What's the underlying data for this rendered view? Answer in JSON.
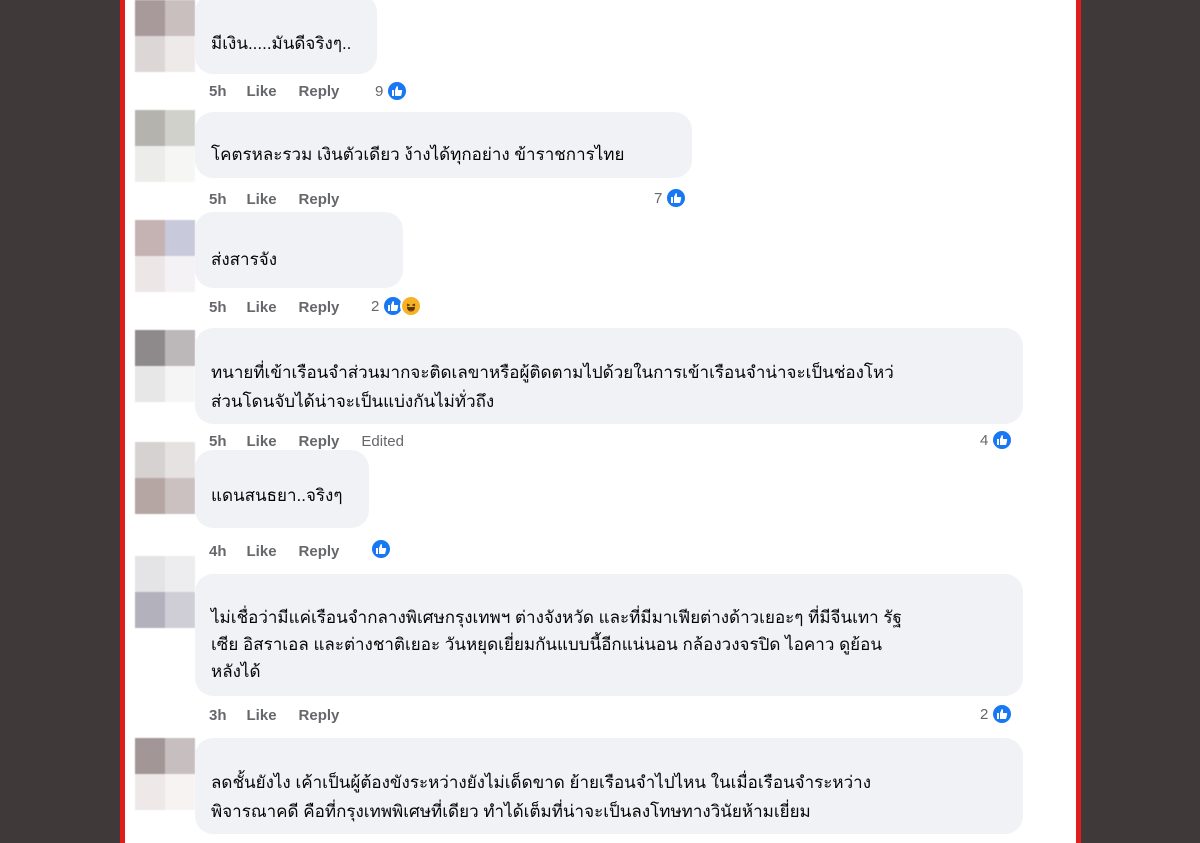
{
  "colors": {
    "page_bg": "#3f3a39",
    "frame_border": "#e21b1b",
    "bubble_bg": "#f0f2f5",
    "text": "#050505",
    "meta_text": "#65676b",
    "like_blue": "#1877f2",
    "haha_yellow": "#f7b125"
  },
  "labels": {
    "like": "Like",
    "reply": "Reply",
    "edited": "Edited"
  },
  "comments": [
    {
      "text": "มีเงิน.....มันดีจริงๆ..",
      "time": "5h",
      "reaction_count": "9",
      "reactions": [
        "like-icon"
      ],
      "avatar_colors": [
        "#a8999a",
        "#c9bfbf",
        "#dcd6d6",
        "#efeaea"
      ]
    },
    {
      "text": "โคตรหละรวม เงินตัวเดียว ง้างได้ทุกอย่าง ข้าราชการไทย",
      "time": "5h",
      "reaction_count": "7",
      "reactions": [
        "like-icon"
      ],
      "avatar_colors": [
        "#b4b3ad",
        "#d1d1cb",
        "#ececea",
        "#f6f6f5"
      ]
    },
    {
      "text": "ส่งสารจัง",
      "time": "5h",
      "reaction_count": "2",
      "reactions": [
        "like-icon",
        "haha-icon"
      ],
      "avatar_colors": [
        "#c5b3b4",
        "#c9c9dc",
        "#ece6e7",
        "#f4f2f4"
      ]
    },
    {
      "text_lines": [
        "ทนายที่เข้าเรือนจำส่วนมากจะติดเลขาหรือผู้ติดตามไปด้วยในการเข้าเรือนจำน่าจะเป็นช่องโหว่",
        "ส่วนโดนจับได้น่าจะเป็นแบ่งกันไม่ทั่วถึง"
      ],
      "time": "5h",
      "edited": true,
      "reaction_count": "4",
      "reactions": [
        "like-icon"
      ],
      "avatar_colors": [
        "#8e8a8b",
        "#bcb7b8",
        "#e8e7e7",
        "#f5f5f5"
      ]
    },
    {
      "text": "แดนสนธยา..จริงๆ",
      "time": "4h",
      "reaction_count": "",
      "reactions": [
        "like-icon"
      ],
      "avatar_colors": [
        "#d6d2d1",
        "#e5e2e1",
        "#b5a6a4",
        "#cbc1c0"
      ]
    },
    {
      "text_lines": [
        "ไม่เชื่อว่ามีแค่เรือนจำกลางพิเศษกรุงเทพฯ ต่างจังหวัด และที่มีมาเฟียต่างด้าวเยอะๆ ที่มีจีนเทา รัฐ",
        "เซีย อิสราเอล และต่างชาติเยอะ วันหยุดเยี่ยมกันแบบนี้อีกแน่นอน กล้องวงจรปิด ไอคาว ดูย้อน",
        "หลังได้"
      ],
      "time": "3h",
      "reaction_count": "2",
      "reactions": [
        "like-icon"
      ],
      "avatar_colors": [
        "#e4e3e6",
        "#ededf0",
        "#b3b1bc",
        "#cfcdd6"
      ]
    },
    {
      "text_lines": [
        "ลดชั้นยังไง เค้าเป็นผู้ต้องขังระหว่างยังไม่เด็ดขาด ย้ายเรือนจำไปไหน ในเมื่อเรือนจำระหว่าง",
        "พิจารณาคดี คือที่กรุงเทพพิเศษที่เดียว ทำได้เต็มที่น่าจะเป็นลงโทษทางวินัยห้ามเยี่ยม"
      ],
      "time": "",
      "reaction_count": "",
      "reactions": [],
      "avatar_colors": [
        "#a39697",
        "#c7bebf",
        "#eee8e8",
        "#f7f3f3"
      ]
    }
  ]
}
